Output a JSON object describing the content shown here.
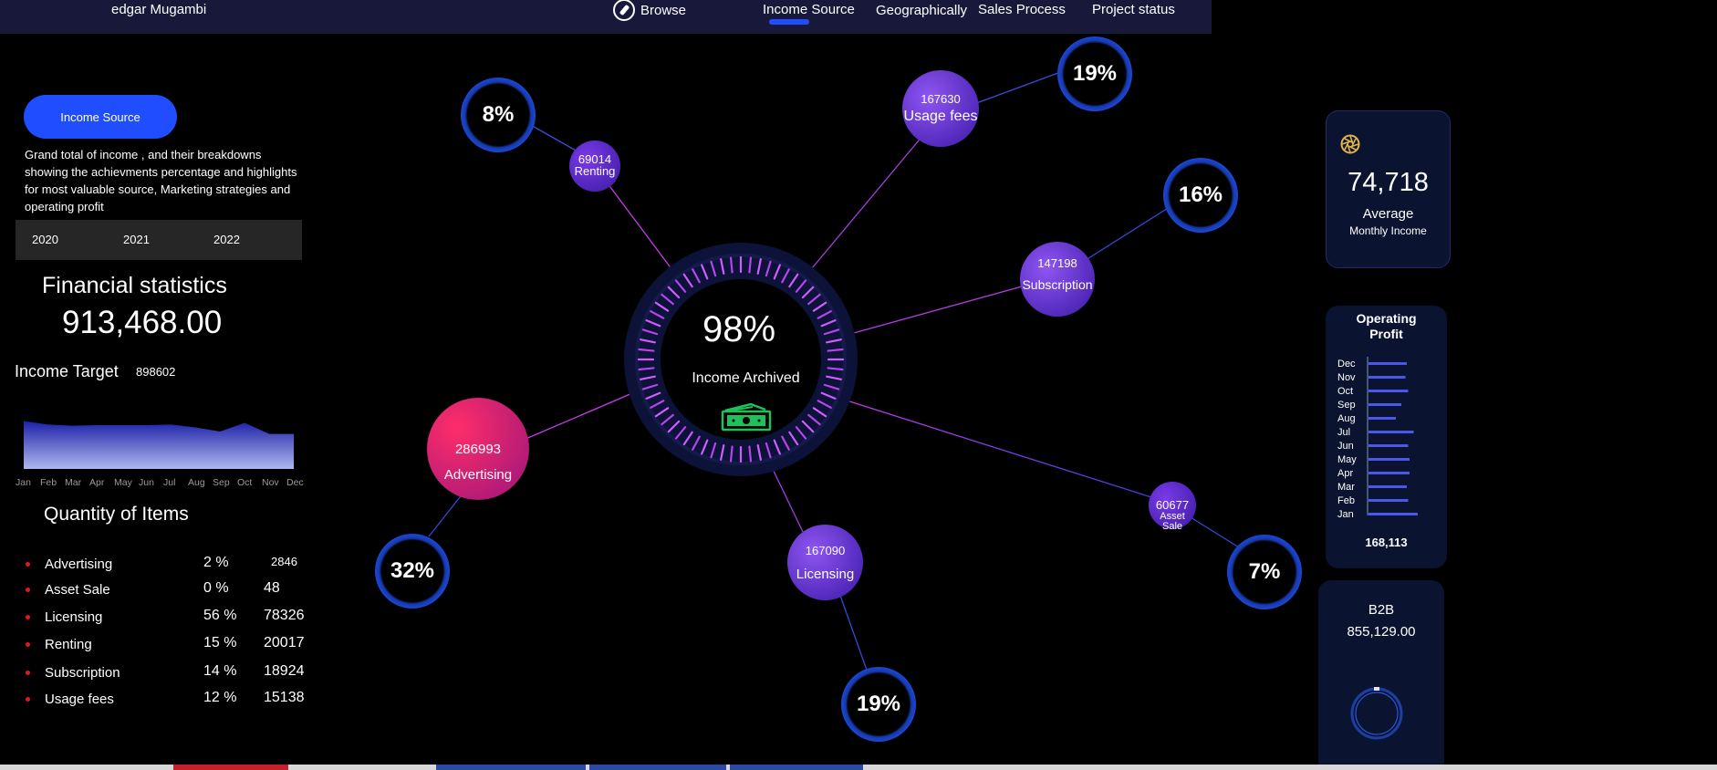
{
  "topbar": {
    "user": "edgar Mugambi",
    "nav": [
      {
        "id": "browse",
        "label": "Browse",
        "icon": "compass-icon"
      },
      {
        "id": "income-source",
        "label": "Income Source",
        "active": true
      },
      {
        "id": "geographically",
        "label": "Geographically"
      },
      {
        "id": "sales-process",
        "label": "Sales Process"
      },
      {
        "id": "project-status",
        "label": "Project status"
      }
    ]
  },
  "left": {
    "button_label": "Income Source",
    "description": "Grand total of income , and their breakdowns showing the achievments percentage and highlights for most valuable source, Marketing strategies and operating profit",
    "years": [
      "2020",
      "2021",
      "2022"
    ],
    "fin_title": "Financial statistics",
    "fin_value": "913,468.00",
    "target_label": "Income Target",
    "target_value": "898602",
    "qty_title": "Quantity of Items",
    "items": [
      {
        "name": "Advertising",
        "pct": "2 %",
        "count": "2846"
      },
      {
        "name": "Asset Sale",
        "pct": "0 %",
        "count": "48"
      },
      {
        "name": "Licensing",
        "pct": "56 %",
        "count": "78326"
      },
      {
        "name": "Renting",
        "pct": "15 %",
        "count": "20017"
      },
      {
        "name": "Subscription",
        "pct": "14 %",
        "count": "18924"
      },
      {
        "name": "Usage fees",
        "pct": "12 %",
        "count": "15138"
      }
    ]
  },
  "hub": {
    "center_pct": "98%",
    "center_label": "Income Archived",
    "sources": [
      {
        "name": "Renting",
        "value": "69014",
        "pct": "8%"
      },
      {
        "name": "Usage fees",
        "value": "167630",
        "pct": "19%"
      },
      {
        "name": "Subscription",
        "value": "147198",
        "pct": "16%"
      },
      {
        "name": "Asset Sale",
        "value": "60677",
        "pct": "7%"
      },
      {
        "name": "Licensing",
        "value": "167090",
        "pct": "19%"
      },
      {
        "name": "Advertising",
        "value": "286993",
        "pct": "32%"
      }
    ]
  },
  "cards": {
    "avg_value": "74,718",
    "avg_label1": "Average",
    "avg_label2": "Monthly Income",
    "op_title_1": "Operating",
    "op_title_2": "Profit",
    "op_total": "168,113",
    "b2b_title": "B2B",
    "b2b_value": "855,129.00"
  },
  "chart_data": [
    {
      "type": "area",
      "categories": [
        "Jan",
        "Feb",
        "Mar",
        "Apr",
        "May",
        "Jun",
        "Jul",
        "Aug",
        "Sep",
        "Oct",
        "Nov",
        "Dec"
      ],
      "values": [
        82,
        76,
        74,
        75,
        75,
        75,
        76,
        71,
        64,
        79,
        60,
        60
      ],
      "ylim": [
        0,
        100
      ],
      "colors": {
        "top": "#1c21a8",
        "bottom": "#aeb8ec"
      }
    },
    {
      "type": "bar",
      "orientation": "horizontal",
      "categories": [
        "Dec",
        "Nov",
        "Oct",
        "Sep",
        "Aug",
        "Jul",
        "Jun",
        "May",
        "Apr",
        "Mar",
        "Feb",
        "Jan"
      ],
      "values": [
        14000,
        13500,
        14500,
        12000,
        10000,
        16500,
        14500,
        15000,
        15000,
        14000,
        14500,
        18000
      ],
      "xlim": [
        0,
        20000
      ],
      "color": "#4a57e8"
    }
  ]
}
